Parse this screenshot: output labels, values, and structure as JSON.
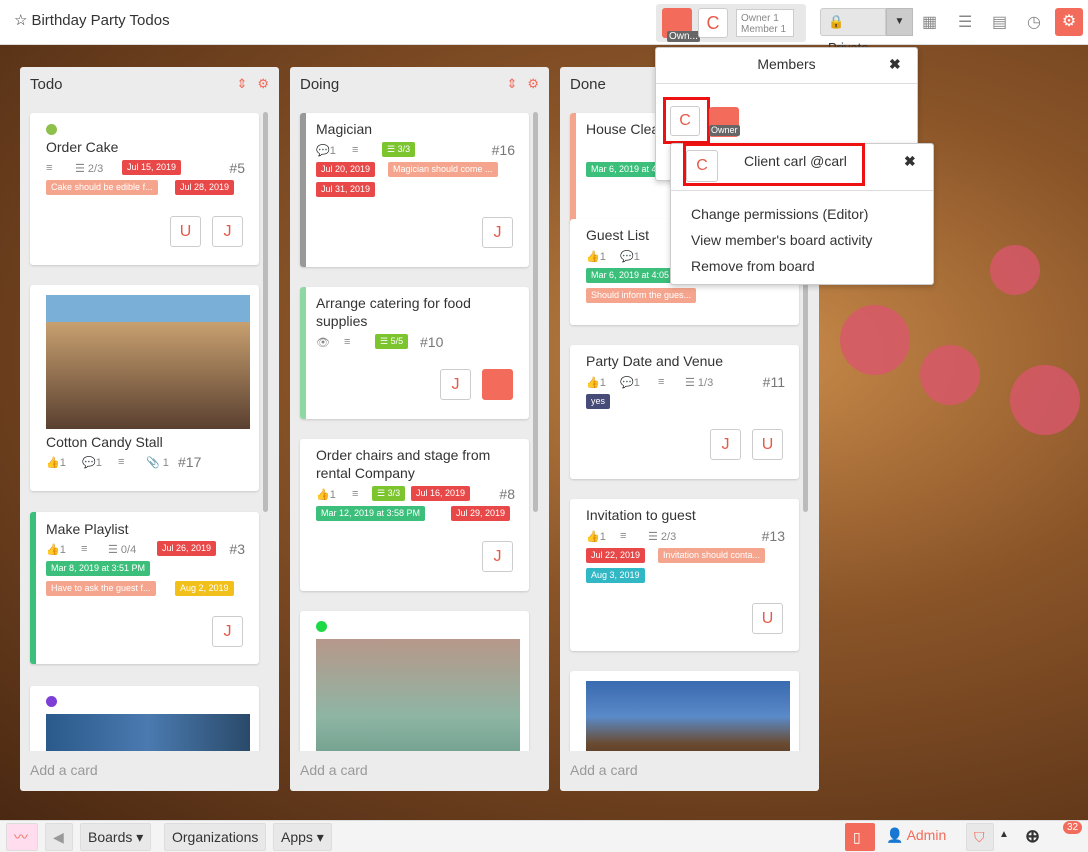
{
  "board": {
    "title": "Birthday Party Todos",
    "visibility": "Private",
    "owner_tag": "Own...",
    "counts_owner": "Owner 1",
    "counts_member": "Member 1",
    "member_initial": "C"
  },
  "lists": [
    {
      "title": "Todo",
      "add_card": "Add a card",
      "cards": [
        {
          "title": "Order Cake",
          "num": "#5",
          "checklist": "2/3",
          "date1": "Jul 15, 2019",
          "label": "Cake should be edible f...",
          "date2": "Jul 28, 2019",
          "members": [
            "U",
            "J"
          ]
        },
        {
          "title": "Cotton Candy Stall",
          "num": "#17",
          "votes": "1",
          "comments": "1",
          "attachments": "1"
        },
        {
          "title": "Make Playlist",
          "num": "#3",
          "votes": "1",
          "checklist": "0/4",
          "date1": "Jul 26, 2019",
          "date2": "Mar 8, 2019 at 3:51 PM",
          "label": "Have to ask the guest f...",
          "date3": "Aug 2, 2019",
          "members": [
            "J"
          ]
        }
      ]
    },
    {
      "title": "Doing",
      "add_card": "Add a card",
      "cards": [
        {
          "title": "Magician",
          "num": "#16",
          "comments": "1",
          "checklist": "3/3",
          "date1": "Jul 20, 2019",
          "label": "Magician should come ...",
          "date2": "Jul 31, 2019",
          "members": [
            "J"
          ]
        },
        {
          "title": "Arrange catering for food supplies",
          "num": "#10",
          "checklist": "5/5",
          "members": [
            "J"
          ]
        },
        {
          "title": "Order chairs and stage from rental Company",
          "num": "#8",
          "votes": "1",
          "checklist": "3/3",
          "date1": "Jul 16, 2019",
          "date2": "Mar 12, 2019 at 3:58 PM",
          "date3": "Jul 29, 2019",
          "members": [
            "J"
          ]
        }
      ]
    },
    {
      "title": "Done",
      "add_card": "Add a card",
      "cards": [
        {
          "title": "House Clea...",
          "date1": "Mar 6, 2019 at 4:0..."
        },
        {
          "title": "Guest List",
          "votes": "1",
          "comments": "1",
          "date1": "Mar 6, 2019 at 4:05",
          "label": "Should inform the gues..."
        },
        {
          "title": "Party Date and Venue",
          "num": "#11",
          "votes": "1",
          "comments": "1",
          "checklist": "1/3",
          "label": "yes",
          "members": [
            "J",
            "U"
          ]
        },
        {
          "title": "Invitation to guest",
          "num": "#13",
          "votes": "1",
          "checklist": "2/3",
          "date1": "Jul 22, 2019",
          "label": "Invitation should conta...",
          "date2": "Aug 3, 2019",
          "members": [
            "U"
          ]
        }
      ]
    }
  ],
  "members_popup": {
    "title": "Members",
    "member_initial": "C",
    "owner_label": "Owner"
  },
  "client_popup": {
    "initial": "C",
    "name": "Client carl @carl",
    "items": [
      "Change permissions (Editor)",
      "View member's board activity",
      "Remove from board"
    ]
  },
  "footer": {
    "boards": "Boards",
    "organizations": "Organizations",
    "apps": "Apps",
    "user": "Admin",
    "notifications": "32"
  }
}
